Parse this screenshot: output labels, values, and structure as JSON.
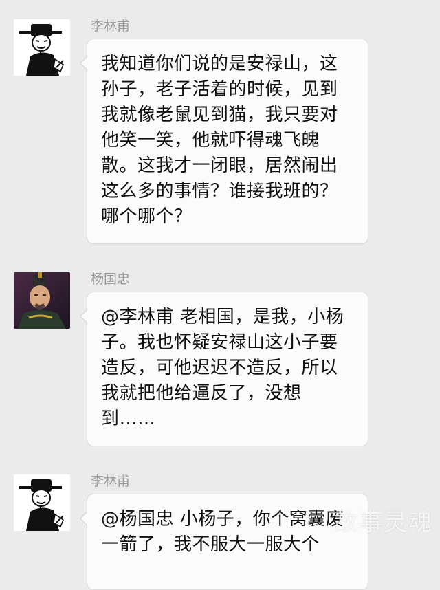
{
  "messages": [
    {
      "sender": "李林甫",
      "avatar_icon": "tang-official-ink-portrait",
      "text": "我知道你们说的是安禄山，这孙子，老子活着的时候，见到我就像老鼠见到猫，我只要对他笑一笑，他就吓得魂飞魄散。这我才一闭眼，居然闹出这么多的事情？谁接我班的？哪个哪个？"
    },
    {
      "sender": "杨国忠",
      "avatar_icon": "tv-drama-minister-photo",
      "text": "@李林甫 老相国，是我，小杨子。我也怀疑安禄山这小子要造反，可他迟迟不造反，所以我就把他给逼反了，没想到……"
    },
    {
      "sender": "李林甫",
      "avatar_icon": "tang-official-ink-portrait",
      "text": "@杨国忠 小杨子，你个窝囊废一箭了，我不服大一服大个"
    }
  ],
  "watermark": "故事灵魂",
  "colors": {
    "background": "#ebebeb",
    "bubble": "#fbfbfb",
    "bubble_border": "#d9d9d9",
    "name": "#999999",
    "text": "#111111"
  }
}
